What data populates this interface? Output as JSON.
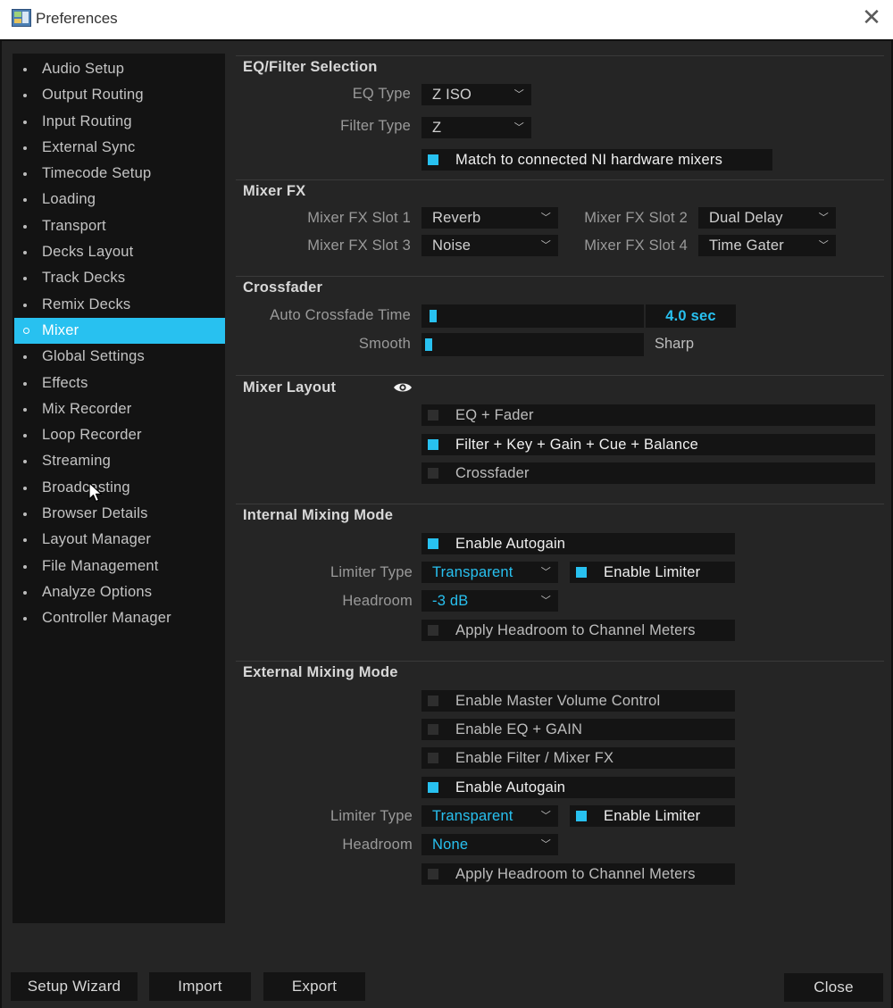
{
  "window": {
    "title": "Preferences",
    "close_glyph": "✕",
    "icon": "app-icon"
  },
  "sidebar": {
    "items": [
      {
        "label": "Audio Setup"
      },
      {
        "label": "Output Routing"
      },
      {
        "label": "Input Routing"
      },
      {
        "label": "External Sync"
      },
      {
        "label": "Timecode Setup"
      },
      {
        "label": "Loading"
      },
      {
        "label": "Transport"
      },
      {
        "label": "Decks Layout"
      },
      {
        "label": "Track Decks"
      },
      {
        "label": "Remix Decks"
      },
      {
        "label": "Mixer",
        "selected": true
      },
      {
        "label": "Global Settings"
      },
      {
        "label": "Effects"
      },
      {
        "label": "Mix Recorder"
      },
      {
        "label": "Loop Recorder"
      },
      {
        "label": "Streaming"
      },
      {
        "label": "Broadcasting"
      },
      {
        "label": "Browser Details"
      },
      {
        "label": "Layout Manager"
      },
      {
        "label": "File Management"
      },
      {
        "label": "Analyze Options"
      },
      {
        "label": "Controller Manager"
      }
    ]
  },
  "eq_filter": {
    "title": "EQ/Filter Selection",
    "eq_type_label": "EQ Type",
    "eq_type_value": "Z ISO",
    "filter_type_label": "Filter Type",
    "filter_type_value": "Z",
    "match_hw_label": "Match to connected NI hardware mixers",
    "match_hw_checked": true
  },
  "mixer_fx": {
    "title": "Mixer FX",
    "slot1_label": "Mixer FX Slot 1",
    "slot1_value": "Reverb",
    "slot2_label": "Mixer FX Slot 2",
    "slot2_value": "Dual Delay",
    "slot3_label": "Mixer FX Slot 3",
    "slot3_value": "Noise",
    "slot4_label": "Mixer FX Slot 4",
    "slot4_value": "Time Gater"
  },
  "crossfader": {
    "title": "Crossfader",
    "auto_time_label": "Auto Crossfade Time",
    "auto_time_value": "4.0 sec",
    "auto_time_fraction": 0.02,
    "smooth_label": "Smooth",
    "sharp_label": "Sharp",
    "curve_fraction": 0.0
  },
  "mixer_layout": {
    "title": "Mixer Layout",
    "eye_icon": "eye-icon",
    "options": [
      {
        "label": "EQ + Fader",
        "checked": false
      },
      {
        "label": "Filter + Key + Gain + Cue + Balance",
        "checked": true
      },
      {
        "label": "Crossfader",
        "checked": false
      }
    ]
  },
  "internal_mixing": {
    "title": "Internal Mixing Mode",
    "autogain_label": "Enable Autogain",
    "autogain_checked": true,
    "limiter_type_label": "Limiter Type",
    "limiter_type_value": "Transparent",
    "enable_limiter_label": "Enable Limiter",
    "enable_limiter_checked": true,
    "headroom_label": "Headroom",
    "headroom_value": "-3 dB",
    "apply_headroom_label": "Apply Headroom to Channel Meters",
    "apply_headroom_checked": false
  },
  "external_mixing": {
    "title": "External Mixing Mode",
    "master_volume_label": "Enable Master Volume Control",
    "master_volume_checked": false,
    "eq_gain_label": "Enable EQ + GAIN",
    "eq_gain_checked": false,
    "filter_fx_label": "Enable Filter / Mixer FX",
    "filter_fx_checked": false,
    "autogain_label": "Enable Autogain",
    "autogain_checked": true,
    "limiter_type_label": "Limiter Type",
    "limiter_type_value": "Transparent",
    "enable_limiter_label": "Enable Limiter",
    "enable_limiter_checked": true,
    "headroom_label": "Headroom",
    "headroom_value": "None",
    "apply_headroom_label": "Apply Headroom to Channel Meters",
    "apply_headroom_checked": false
  },
  "footer": {
    "setup_wizard_label": "Setup Wizard",
    "import_label": "Import",
    "export_label": "Export",
    "close_label": "Close"
  },
  "colors": {
    "accent": "#28c1f0",
    "background": "#252525",
    "panel": "#131313",
    "control": "#141414"
  }
}
